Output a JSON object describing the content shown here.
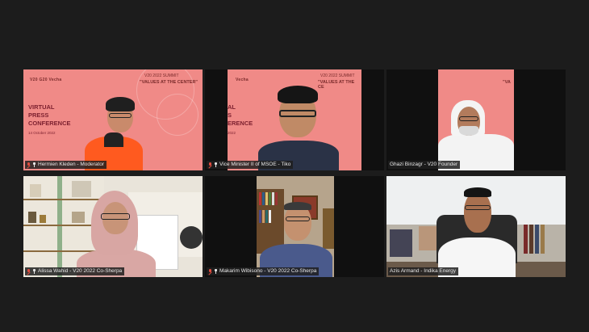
{
  "participants": [
    {
      "name": "Hermien Kleden - Moderator",
      "muted": true,
      "pinned": true
    },
    {
      "name": "Vice Minister II of MSOE - Tiko",
      "muted": true,
      "pinned": true
    },
    {
      "name": "Ghazi Binzagr - V20 Founder",
      "muted": false,
      "pinned": false
    },
    {
      "name": "Alissa Wahid - V20 2022 Co-Sherpa",
      "muted": true,
      "pinned": true
    },
    {
      "name": "Makarim Wibisono - V20 2022 Co-Sherpa",
      "muted": true,
      "pinned": true
    },
    {
      "name": "Azis Armand - Indika Energy",
      "muted": false,
      "pinned": false
    }
  ],
  "slide": {
    "logos": "V20  G20  Vecha",
    "summit": "V20 2022 SUMMIT",
    "values": "\"VALUES AT THE CENTER\"",
    "values_partial": "\"VALUES AT THE CE",
    "values_short": "\"VA",
    "line1": "VIRTUAL",
    "line2": "PRESS",
    "line3": "CONFERENCE",
    "line1_cut": "AL",
    "line2_cut": "S",
    "line3_cut": "ERENCE",
    "date": "14 October 2022",
    "date_cut": "2022",
    "vecha": "Vecha"
  },
  "colors": {
    "slide_bg": "#f08a87",
    "slide_text": "#7b1f2e",
    "page_bg": "#1c1c1c",
    "mic_muted": "#e24c3f"
  }
}
